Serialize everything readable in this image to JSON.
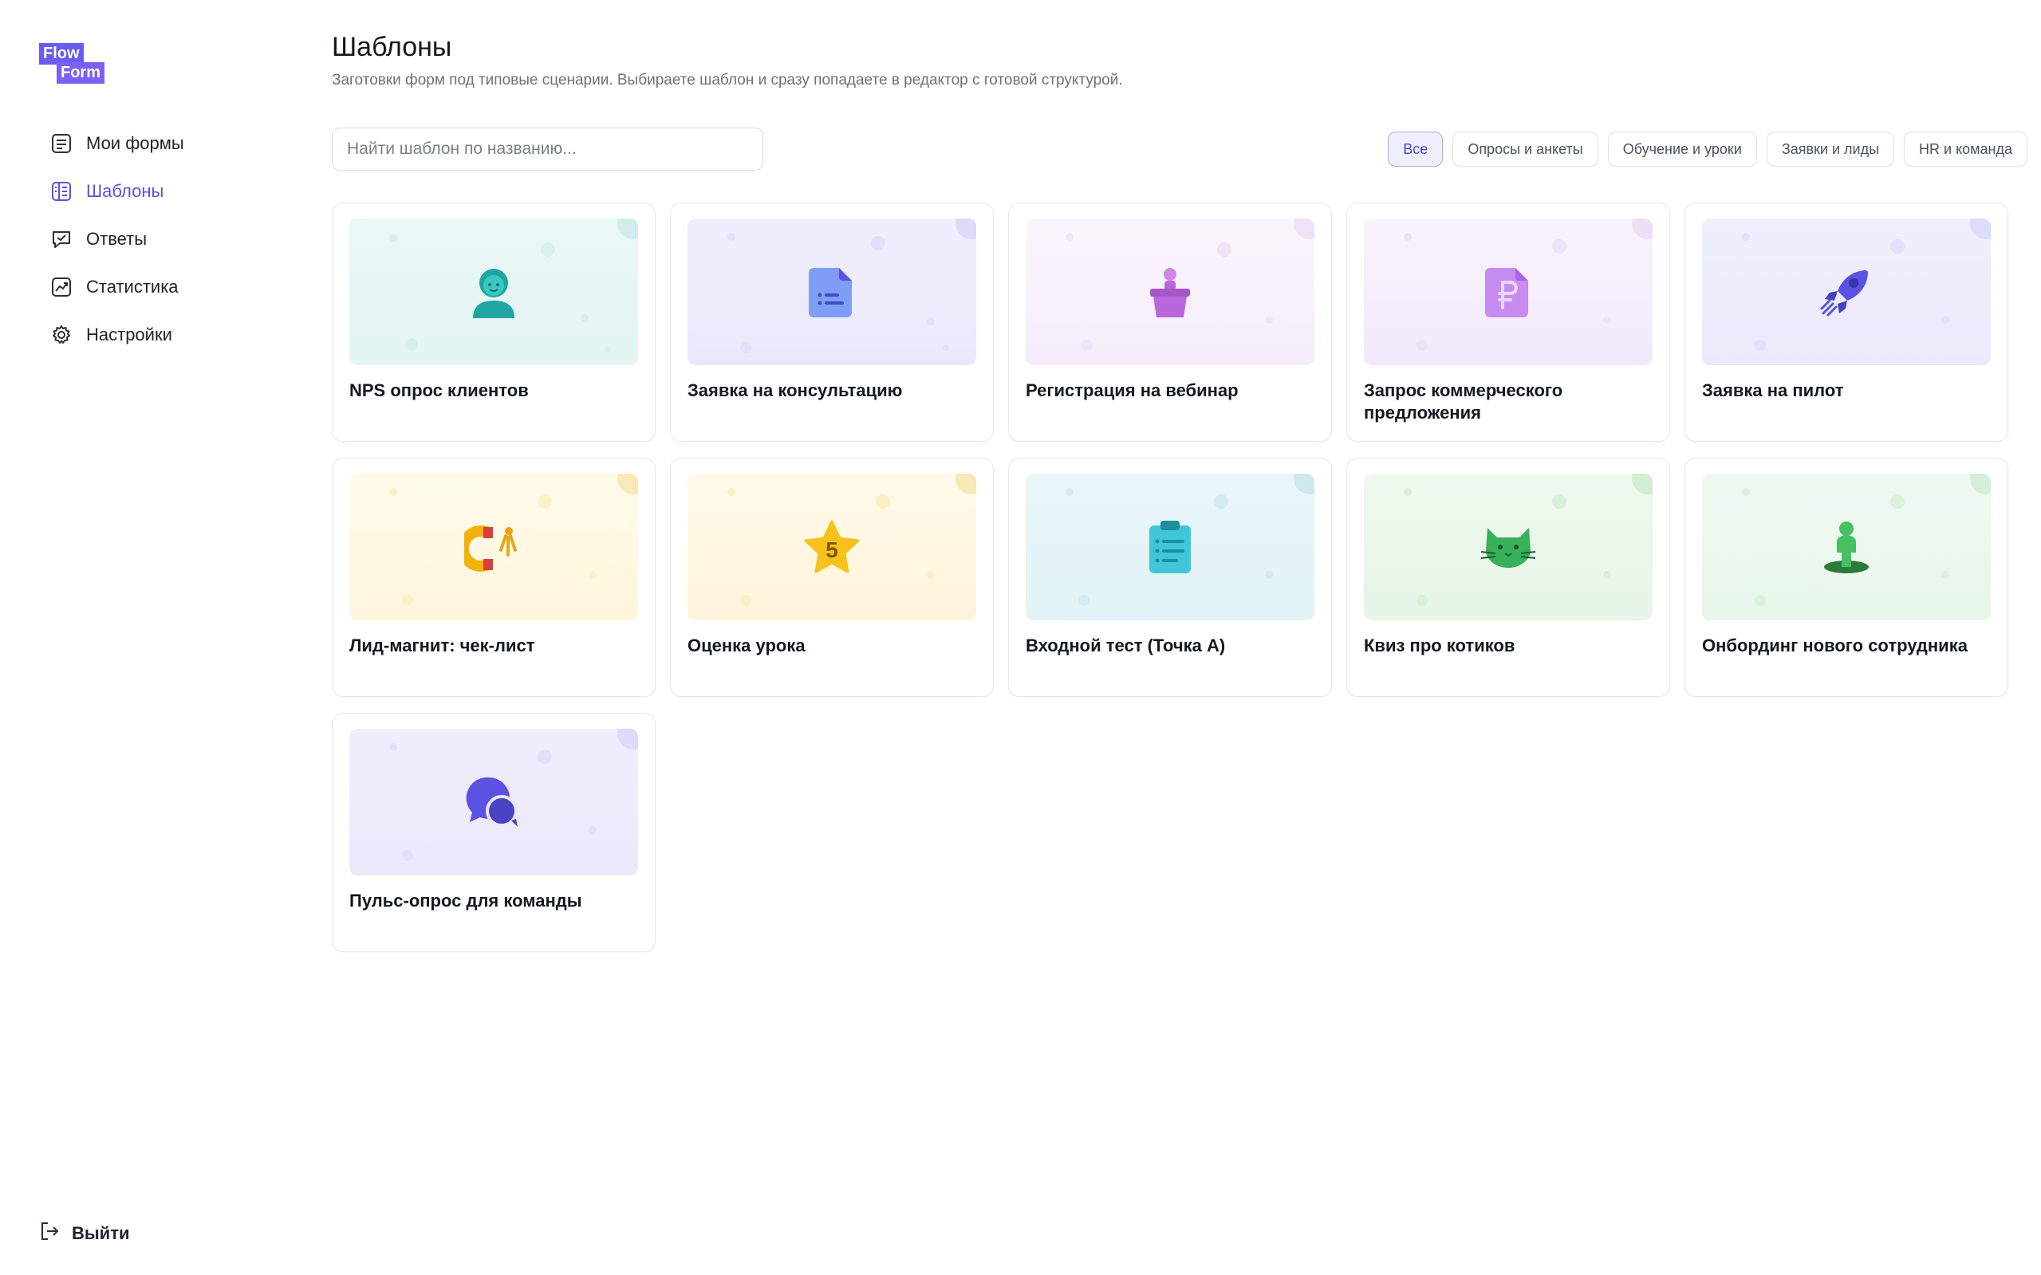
{
  "logo": {
    "line1": "Flow",
    "line2": "Form"
  },
  "nav": [
    {
      "label": "Мои формы",
      "icon": "forms-icon"
    },
    {
      "label": "Шаблоны",
      "icon": "templates-icon",
      "active": true
    },
    {
      "label": "Ответы",
      "icon": "answers-icon"
    },
    {
      "label": "Статистика",
      "icon": "stats-icon"
    },
    {
      "label": "Настройки",
      "icon": "gear-icon"
    }
  ],
  "logout": {
    "label": "Выйти"
  },
  "page": {
    "title": "Шаблоны",
    "subtitle": "Заготовки форм под типовые сценарии. Выбираете шаблон и сразу попадаете в редактор с готовой структурой."
  },
  "search": {
    "placeholder": "Найти шаблон по названию...",
    "value": ""
  },
  "filters": [
    {
      "label": "Все",
      "active": true
    },
    {
      "label": "Опросы и анкеты"
    },
    {
      "label": "Обучение и уроки"
    },
    {
      "label": "Заявки и лиды"
    },
    {
      "label": "HR и команда"
    }
  ],
  "templates": [
    {
      "title": "NPS опрос клиентов",
      "icon": "customer-icon"
    },
    {
      "title": "Заявка на консультацию",
      "icon": "document-icon"
    },
    {
      "title": "Регистрация на вебинар",
      "icon": "speaker-podium-icon"
    },
    {
      "title": "Запрос коммерческого предложения",
      "icon": "ruble-document-icon"
    },
    {
      "title": "Заявка на пилот",
      "icon": "rocket-icon"
    },
    {
      "title": "Лид-магнит: чек-лист",
      "icon": "magnet-icon"
    },
    {
      "title": "Оценка урока",
      "icon": "star-5-icon",
      "badge": "5"
    },
    {
      "title": "Входной тест (Точка А)",
      "icon": "clipboard-icon"
    },
    {
      "title": "Квиз про котиков",
      "icon": "cat-icon"
    },
    {
      "title": "Онбординг нового сотрудника",
      "icon": "person-on-spot-icon"
    },
    {
      "title": "Пульс-опрос для команды",
      "icon": "chat-bubbles-icon"
    }
  ],
  "colors": {
    "accent": "#5a52e0",
    "logo_primary": "#6a5cf0",
    "logo_secondary": "#7d5ff3"
  }
}
